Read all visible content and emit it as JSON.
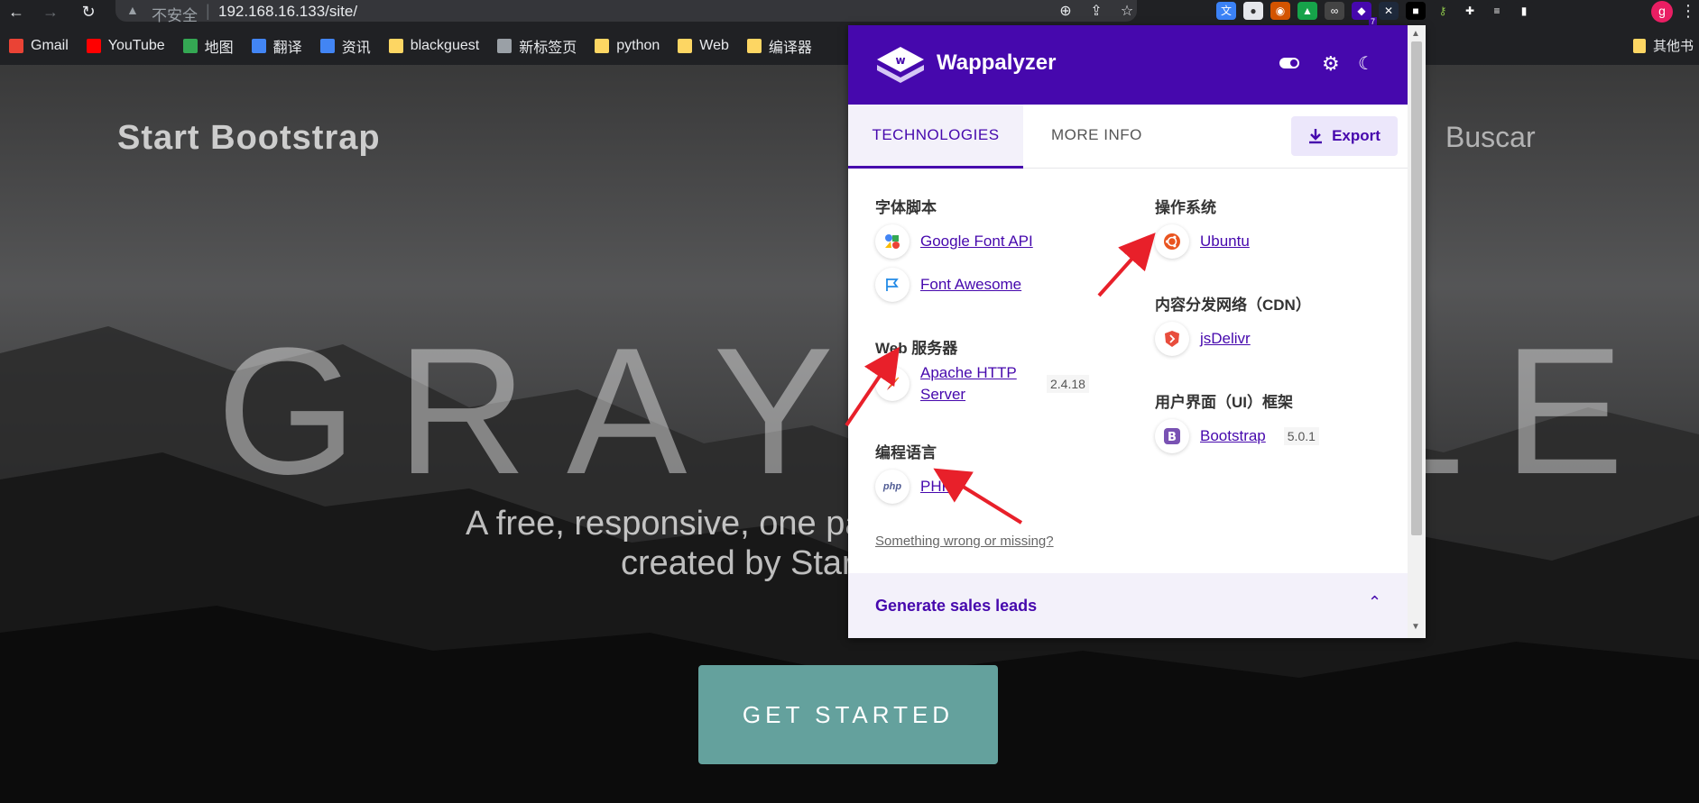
{
  "browser": {
    "address": {
      "security_label": "不安全",
      "url": "192.168.16.133/site/"
    },
    "extension_badge": "7",
    "profile_initial": "g"
  },
  "bookmarks": [
    {
      "label": "Gmail",
      "color": "#ea4335"
    },
    {
      "label": "YouTube",
      "color": "#ff0000"
    },
    {
      "label": "地图",
      "color": "#34a853"
    },
    {
      "label": "翻译",
      "color": "#4285f4"
    },
    {
      "label": "资讯",
      "color": "#4285f4"
    },
    {
      "label": "blackguest",
      "color": "#fdd663"
    },
    {
      "label": "新标签页",
      "color": "#9aa0a6"
    },
    {
      "label": "python",
      "color": "#fdd663"
    },
    {
      "label": "Web",
      "color": "#fdd663"
    },
    {
      "label": "编译器",
      "color": "#fdd663"
    }
  ],
  "other_bookmarks": "其他书",
  "site": {
    "brand": "Start Bootstrap",
    "search": "Buscar",
    "hero_title": "GRAYSCALE",
    "hero_subtitle_1": "A free, responsive, one page Bootstrap theme",
    "hero_subtitle_2": "created by Start Bootstrap.",
    "cta": "GET STARTED"
  },
  "wappalyzer": {
    "title": "Wappalyzer",
    "tabs": {
      "technologies": "TECHNOLOGIES",
      "more_info": "MORE INFO"
    },
    "export": "Export",
    "categories": {
      "font_scripts": {
        "title": "字体脚本",
        "items": [
          {
            "name": "Google Font API",
            "version": ""
          },
          {
            "name": "Font Awesome",
            "version": ""
          }
        ]
      },
      "web_servers": {
        "title": "Web 服务器",
        "items": [
          {
            "name": "Apache HTTP Server",
            "version": "2.4.18"
          }
        ]
      },
      "programming_languages": {
        "title": "编程语言",
        "items": [
          {
            "name": "PHP",
            "version": ""
          }
        ]
      },
      "operating_systems": {
        "title": "操作系统",
        "items": [
          {
            "name": "Ubuntu",
            "version": ""
          }
        ]
      },
      "cdn": {
        "title": "内容分发网络（CDN）",
        "items": [
          {
            "name": "jsDelivr",
            "version": ""
          }
        ]
      },
      "ui_frameworks": {
        "title": "用户界面（UI）框架",
        "items": [
          {
            "name": "Bootstrap",
            "version": "5.0.1"
          }
        ]
      }
    },
    "something_wrong": "Something wrong or missing?",
    "leads_title": "Generate sales leads"
  },
  "colors": {
    "wappalyzer_purple": "#4608ad",
    "cta_teal": "#64a19d",
    "annotation_arrow": "#e8202a"
  }
}
